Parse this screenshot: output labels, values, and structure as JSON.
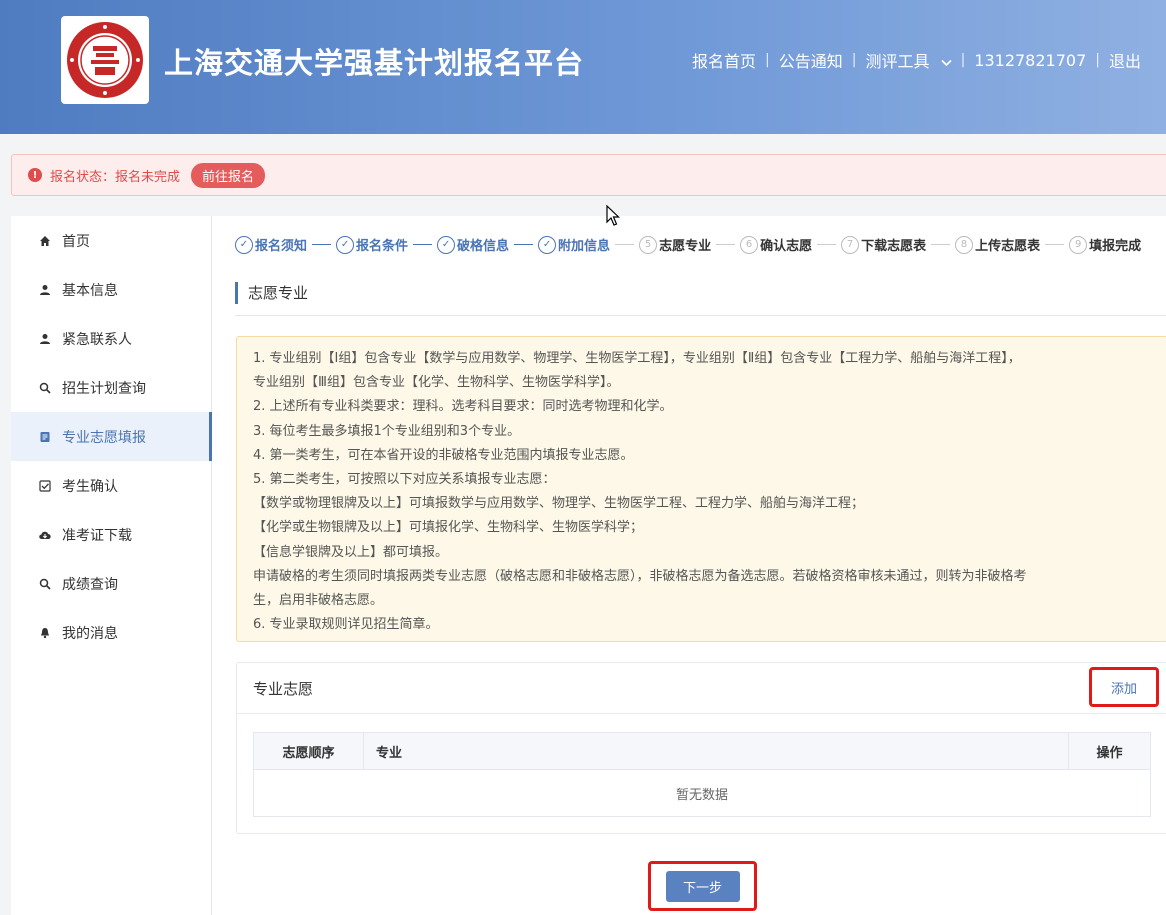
{
  "header": {
    "site_title": "上海交通大学强基计划报名平台",
    "nav": {
      "home": "报名首页",
      "notice": "公告通知",
      "tools": "测评工具",
      "phone": "13127821707",
      "logout": "退出"
    },
    "separator": "|"
  },
  "alert": {
    "icon": "!",
    "text": "报名状态：报名未完成",
    "button": "前往报名"
  },
  "sidebar": {
    "items": [
      {
        "label": "首页",
        "icon": "home-icon"
      },
      {
        "label": "基本信息",
        "icon": "user-icon"
      },
      {
        "label": "紧急联系人",
        "icon": "user-icon"
      },
      {
        "label": "招生计划查询",
        "icon": "search-icon"
      },
      {
        "label": "专业志愿填报",
        "icon": "document-icon"
      },
      {
        "label": "考生确认",
        "icon": "checkbox-icon"
      },
      {
        "label": "准考证下载",
        "icon": "cloud-download-icon"
      },
      {
        "label": "成绩查询",
        "icon": "search-icon"
      },
      {
        "label": "我的消息",
        "icon": "bell-icon"
      }
    ]
  },
  "steps": {
    "s1": {
      "num": "✓",
      "label": "报名须知"
    },
    "s2": {
      "num": "✓",
      "label": "报名条件"
    },
    "s3": {
      "num": "✓",
      "label": "破格信息"
    },
    "s4": {
      "num": "✓",
      "label": "附加信息"
    },
    "s5": {
      "num": "5",
      "label": "志愿专业"
    },
    "s6": {
      "num": "6",
      "label": "确认志愿"
    },
    "s7": {
      "num": "7",
      "label": "下载志愿表"
    },
    "s8": {
      "num": "8",
      "label": "上传志愿表"
    },
    "s9": {
      "num": "9",
      "label": "填报完成"
    }
  },
  "section_title": "志愿专业",
  "notice": {
    "lines": [
      "1. 专业组别【Ⅰ组】包含专业【数学与应用数学、物理学、生物医学工程】，专业组别【Ⅱ组】包含专业【工程力学、船舶与海洋工程】，",
      "专业组别【Ⅲ组】包含专业【化学、生物科学、生物医学科学】。",
      "2. 上述所有专业科类要求：理科。选考科目要求：同时选考物理和化学。",
      "3. 每位考生最多填报1个专业组别和3个专业。",
      "4. 第一类考生，可在本省开设的非破格专业范围内填报专业志愿。",
      "5. 第二类考生，可按照以下对应关系填报专业志愿：",
      "【数学或物理银牌及以上】可填报数学与应用数学、物理学、生物医学工程、工程力学、船舶与海洋工程；",
      "【化学或生物银牌及以上】可填报化学、生物科学、生物医学科学；",
      "【信息学银牌及以上】都可填报。",
      "申请破格的考生须同时填报两类专业志愿（破格志愿和非破格志愿），非破格志愿为备选志愿。若破格资格审核未通过，则转为非破格考",
      "生，启用非破格志愿。",
      "6. 专业录取规则详见招生简章。"
    ]
  },
  "card": {
    "title": "专业志愿",
    "add": "添加",
    "columns": {
      "order": "志愿顺序",
      "major": "专业",
      "op": "操作"
    },
    "empty": "暂无数据"
  },
  "next_button": "下一步",
  "colors": {
    "primary": "#4a74b4",
    "alert": "#e04b4b",
    "highlight": "#e01919"
  }
}
